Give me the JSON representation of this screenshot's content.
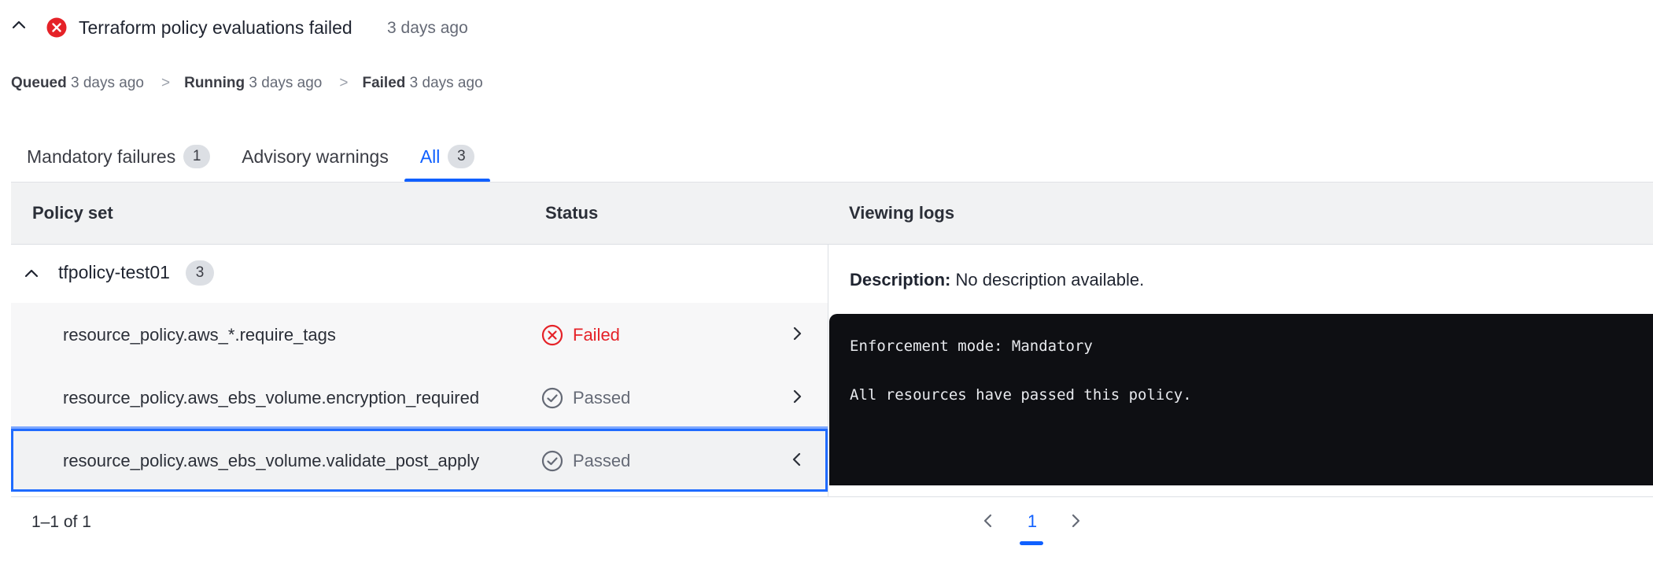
{
  "header": {
    "title": "Terraform policy evaluations failed",
    "time": "3 days ago"
  },
  "steps": [
    {
      "label": "Queued",
      "time": "3 days ago"
    },
    {
      "label": "Running",
      "time": "3 days ago"
    },
    {
      "label": "Failed",
      "time": "3 days ago"
    }
  ],
  "step_separator": ">",
  "tabs": [
    {
      "label": "Mandatory failures",
      "count": "1"
    },
    {
      "label": "Advisory warnings",
      "count": ""
    },
    {
      "label": "All",
      "count": "3",
      "active": true
    }
  ],
  "table": {
    "headers": {
      "policy_set": "Policy set",
      "status": "Status",
      "logs": "Viewing logs"
    },
    "group": {
      "name": "tfpolicy-test01",
      "count": "3"
    },
    "rows": [
      {
        "name": "resource_policy.aws_*.require_tags",
        "status": "Failed"
      },
      {
        "name": "resource_policy.aws_ebs_volume.encryption_required",
        "status": "Passed"
      },
      {
        "name": "resource_policy.aws_ebs_volume.validate_post_apply",
        "status": "Passed",
        "selected": true
      }
    ]
  },
  "logs": {
    "description_label": "Description:",
    "description_value": "No description available.",
    "lines": [
      "Enforcement mode: Mandatory",
      "All resources have passed this policy."
    ]
  },
  "pagination": {
    "range": "1–1 of 1",
    "current_page": "1"
  },
  "colors": {
    "accent": "#1060ff",
    "error": "#e52228",
    "passed": "#656a76",
    "log_bg": "#0e0f13"
  },
  "icons": {
    "header_toggle": "chevron-up-icon",
    "header_status": "error-circle-icon",
    "failed": "x-circle-icon",
    "passed": "check-circle-icon"
  }
}
